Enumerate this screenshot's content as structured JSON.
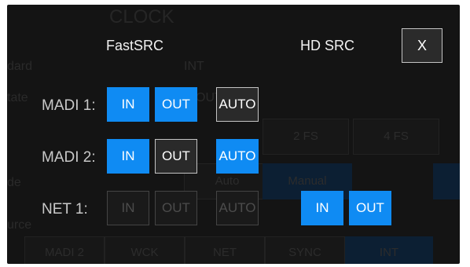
{
  "background": {
    "title": "CLOCK",
    "labels": [
      "dard",
      "tate",
      "INT",
      "OUTPUT",
      "de",
      "urce"
    ],
    "fs_options": [
      "2 FS",
      "4 FS"
    ],
    "mode_options": [
      "Auto",
      "Manual"
    ],
    "sources": [
      "MADI 2",
      "WCK",
      "NET",
      "SYNC",
      "INT"
    ]
  },
  "dialog": {
    "fastsrc_label": "FastSRC",
    "hdsrc_label": "HD SRC",
    "close_label": "X",
    "rows": [
      {
        "label": "MADI 1:",
        "in": "IN",
        "out": "OUT",
        "auto": "AUTO",
        "in_state": "on",
        "out_state": "on",
        "auto_state": "off"
      },
      {
        "label": "MADI 2:",
        "in": "IN",
        "out": "OUT",
        "auto": "AUTO",
        "in_state": "on",
        "out_state": "off",
        "auto_state": "on"
      },
      {
        "label": "NET 1:",
        "in": "IN",
        "out": "OUT",
        "auto": "AUTO",
        "in_state": "disabled",
        "out_state": "disabled",
        "auto_state": "disabled",
        "hd_in": "IN",
        "hd_out": "OUT",
        "hd_in_state": "on",
        "hd_out_state": "on"
      }
    ]
  },
  "colors": {
    "active": "#0f8bf3",
    "inactive": "#2a2a2a",
    "window": "#141414"
  }
}
